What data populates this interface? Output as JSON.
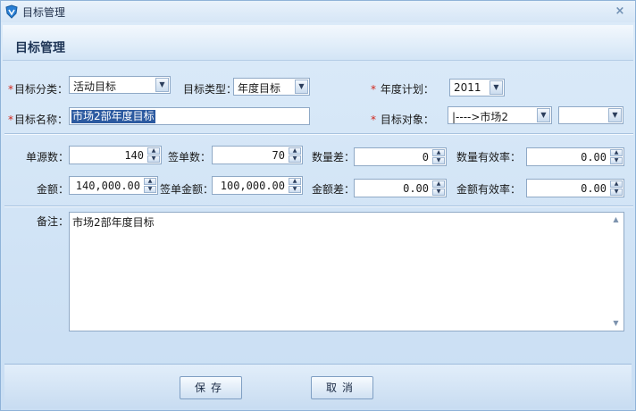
{
  "window": {
    "title": "目标管理",
    "close_glyph": "×"
  },
  "header": {
    "title": "目标管理"
  },
  "form": {
    "required_mark": "*",
    "category": {
      "label": "目标分类：",
      "value": "活动目标"
    },
    "type": {
      "label": "目标类型：",
      "value": "年度目标"
    },
    "year_plan": {
      "label": "年度计划：",
      "value": "2011"
    },
    "name": {
      "label": "目标名称：",
      "value": "市场2部年度目标"
    },
    "target_object": {
      "label": "目标对象：",
      "value": "|---->市场2",
      "secondary_value": ""
    }
  },
  "stats": {
    "order_source_count": {
      "label": "单源数：",
      "value": "140"
    },
    "signed_count": {
      "label": "签单数：",
      "value": "70"
    },
    "count_diff": {
      "label": "数量差：",
      "value": "0"
    },
    "count_efficiency": {
      "label": "数量有效率：",
      "value": "0.00"
    },
    "amount": {
      "label": "金额：",
      "value": "140,000.00"
    },
    "signed_amount": {
      "label": "签单金额：",
      "value": "100,000.00"
    },
    "amount_diff": {
      "label": "金额差：",
      "value": "0.00"
    },
    "amount_efficiency": {
      "label": "金额有效率：",
      "value": "0.00"
    }
  },
  "remark": {
    "label": "备注：",
    "value": "市场2部年度目标"
  },
  "footer": {
    "save_label": "保存",
    "cancel_label": "取消"
  },
  "icons": {
    "dropdown": "chevron-down-icon",
    "spin_up": "spin-up-icon",
    "spin_down": "spin-down-icon"
  },
  "colors": {
    "accent": "#2c5aa0",
    "required": "#d0261c",
    "background": "#cfe3f6"
  }
}
